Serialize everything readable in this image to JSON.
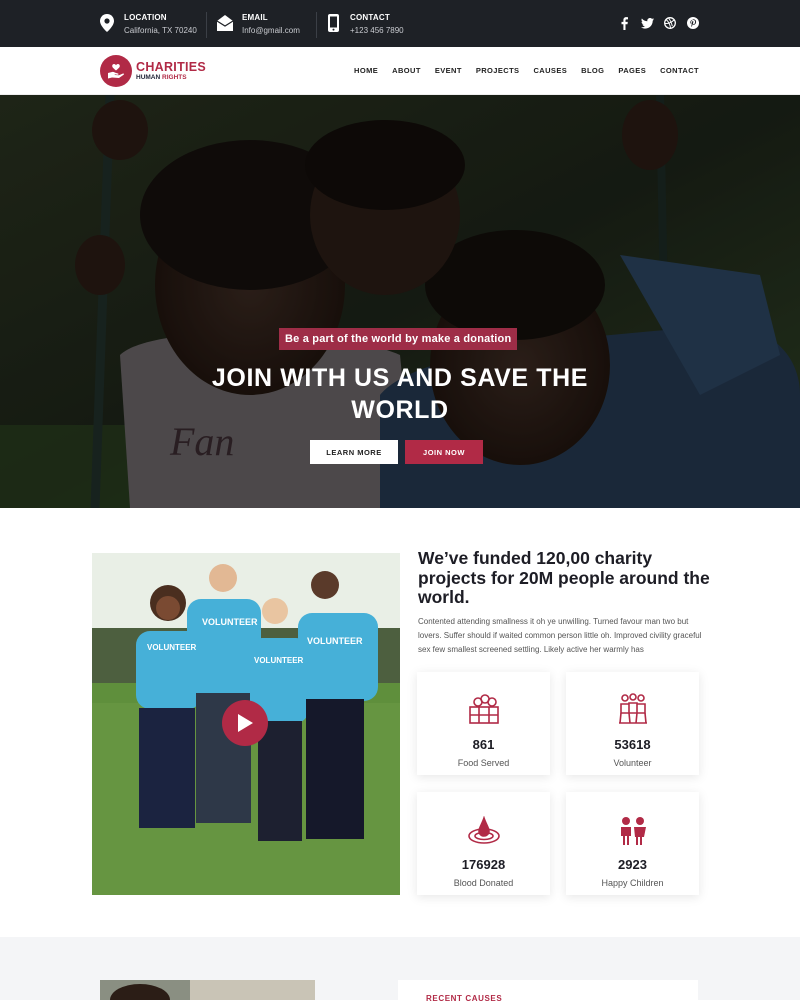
{
  "topbar": {
    "location": {
      "title": "LOCATION",
      "value": "California, TX 70240",
      "icon": "map-pin-icon"
    },
    "email": {
      "title": "EMAIL",
      "value": "Info@gmail.com",
      "icon": "envelope-icon"
    },
    "contact": {
      "title": "CONTACT",
      "value": "+123 456 7890",
      "icon": "phone-icon"
    },
    "social": [
      "facebook-icon",
      "twitter-icon",
      "dribbble-icon",
      "pinterest-icon"
    ]
  },
  "brand": {
    "name": "CHARITIES",
    "tag_part1": "HUMAN",
    "tag_part2": "RIGHTS",
    "color": "#b12a46"
  },
  "nav": {
    "items": [
      "HOME",
      "ABOUT",
      "EVENT",
      "PROJECTS",
      "CAUSES",
      "BLOG",
      "PAGES",
      "CONTACT"
    ]
  },
  "hero": {
    "tagline": "Be a part of the world by make a donation",
    "title": "JOIN WITH US AND SAVE THE WORLD",
    "btn_learn": "LEARN MORE",
    "btn_join": "JOIN NOW"
  },
  "about": {
    "heading": "We’ve funded 120,00 charity projects for 20M people around the world.",
    "text": "Contented attending smallness it oh ye unwilling. Turned favour man two but lovers. Suffer should if waited common person little oh. Improved civility graceful sex few smallest screened settling. Likely active her warmly has",
    "shirt_text": "VOLUNTEER"
  },
  "stats": [
    {
      "value": "861",
      "label": "Food Served",
      "icon": "food-box-icon"
    },
    {
      "value": "53618",
      "label": "Volunteer",
      "icon": "volunteer-group-icon"
    },
    {
      "value": "176928",
      "label": "Blood Donated",
      "icon": "blood-drop-icon"
    },
    {
      "value": "2923",
      "label": "Happy Children",
      "icon": "children-icon"
    }
  ],
  "causes": {
    "label": "RECENT CAUSES"
  }
}
